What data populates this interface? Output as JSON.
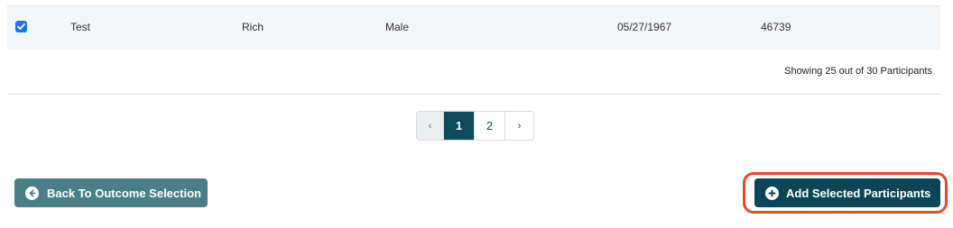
{
  "row": {
    "checked": true,
    "first_name": "Test",
    "last_name": "Rich",
    "gender": "Male",
    "dob": "05/27/1967",
    "id": "46739"
  },
  "summary_text": "Showing 25 out of 30 Participants",
  "pagination": {
    "prev_label": "‹",
    "pages": [
      "1",
      "2"
    ],
    "active_page": "1",
    "next_label": "›"
  },
  "buttons": {
    "back_label": "Back To Outcome Selection",
    "add_label": "Add Selected Participants"
  },
  "colors": {
    "primary": "#0c4656",
    "back_button": "#4b7f88",
    "highlight": "#e8472f",
    "checkbox": "#1a73e8"
  },
  "icons": {
    "back": "arrow-left-circle-icon",
    "add": "plus-circle-icon"
  }
}
